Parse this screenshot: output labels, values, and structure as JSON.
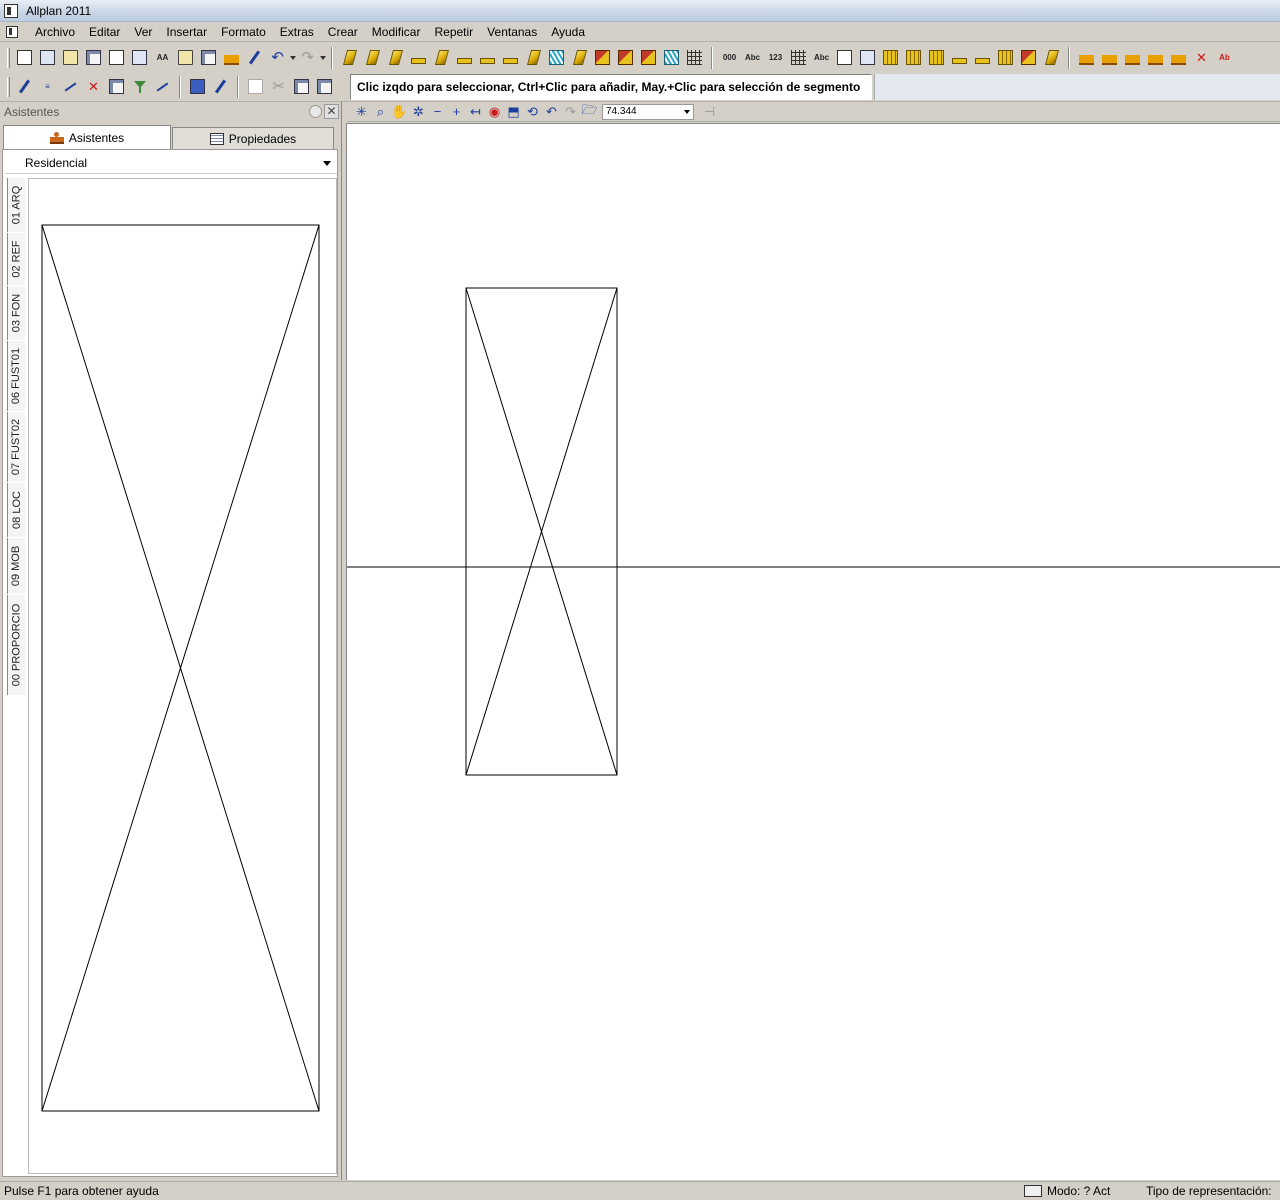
{
  "window": {
    "title": "Allplan 2011"
  },
  "menu": [
    "Archivo",
    "Editar",
    "Ver",
    "Insertar",
    "Formato",
    "Extras",
    "Crear",
    "Modificar",
    "Repetir",
    "Ventanas",
    "Ayuda"
  ],
  "toolbar": {
    "row1_standard_icons": [
      "new-file-icon",
      "open-project-icon",
      "open-file-icon",
      "save-icon",
      "print-preview-icon",
      "list-icon",
      "text-icon",
      "export-icon",
      "save-all-icon",
      "measure-icon",
      "pen-icon",
      "undo-icon",
      "redo-icon"
    ],
    "row1_create_icons": [
      "wall-icon",
      "wall-icon",
      "wall-icon",
      "column-icon",
      "beam-icon",
      "slab-icon",
      "stair-icon",
      "stair-icon",
      "opening-icon",
      "window-icon",
      "hatch-icon",
      "door-icon",
      "roof-icon",
      "fill-icon",
      "grid-icon",
      "railing-icon",
      "dimension-icon",
      "text-label-icon",
      "number-icon",
      "grid-label-icon",
      "label-icon",
      "report-icon",
      "room-icon",
      "room-icon",
      "room-icon",
      "finish-icon",
      "finish-icon",
      "finish-icon",
      "finish-icon",
      "finish-icon",
      "finish-icon",
      "level-icon",
      "level-icon",
      "level-icon",
      "level-icon",
      "level-icon",
      "delete-icon",
      "text-red-icon"
    ],
    "row2_icons": [
      "eyedropper-icon",
      "layer-icon",
      "snap-icon",
      "delete-line-icon",
      "properties-icon",
      "filter-icon",
      "select-icon",
      "object-icon",
      "brush-icon",
      "copy-icon",
      "cut-icon",
      "paste-icon",
      "paste-special-icon"
    ]
  },
  "message_bar": {
    "text": "Clic izqdo para seleccionar, Ctrl+Clic para añadir, May.+Clic para selección de segmento"
  },
  "left_panel": {
    "title": "Asistentes",
    "tabs": [
      {
        "label": "Asistentes",
        "active": true
      },
      {
        "label": "Propiedades",
        "active": false
      }
    ],
    "dropdown": {
      "value": "Residencial"
    },
    "vertical_tabs": [
      "01 ARQ",
      "02 REF",
      "03 FON",
      "06 FUST01",
      "07 FUST02",
      "08 LOC",
      "09 MOB",
      "00 PROPORCIO"
    ]
  },
  "viewport": {
    "zoom_value": "74.344"
  },
  "status_bar": {
    "help_text": "Pulse F1 para obtener ayuda",
    "mode_text": "Modo:  ? Act",
    "representation_text": "Tipo de representación:"
  }
}
